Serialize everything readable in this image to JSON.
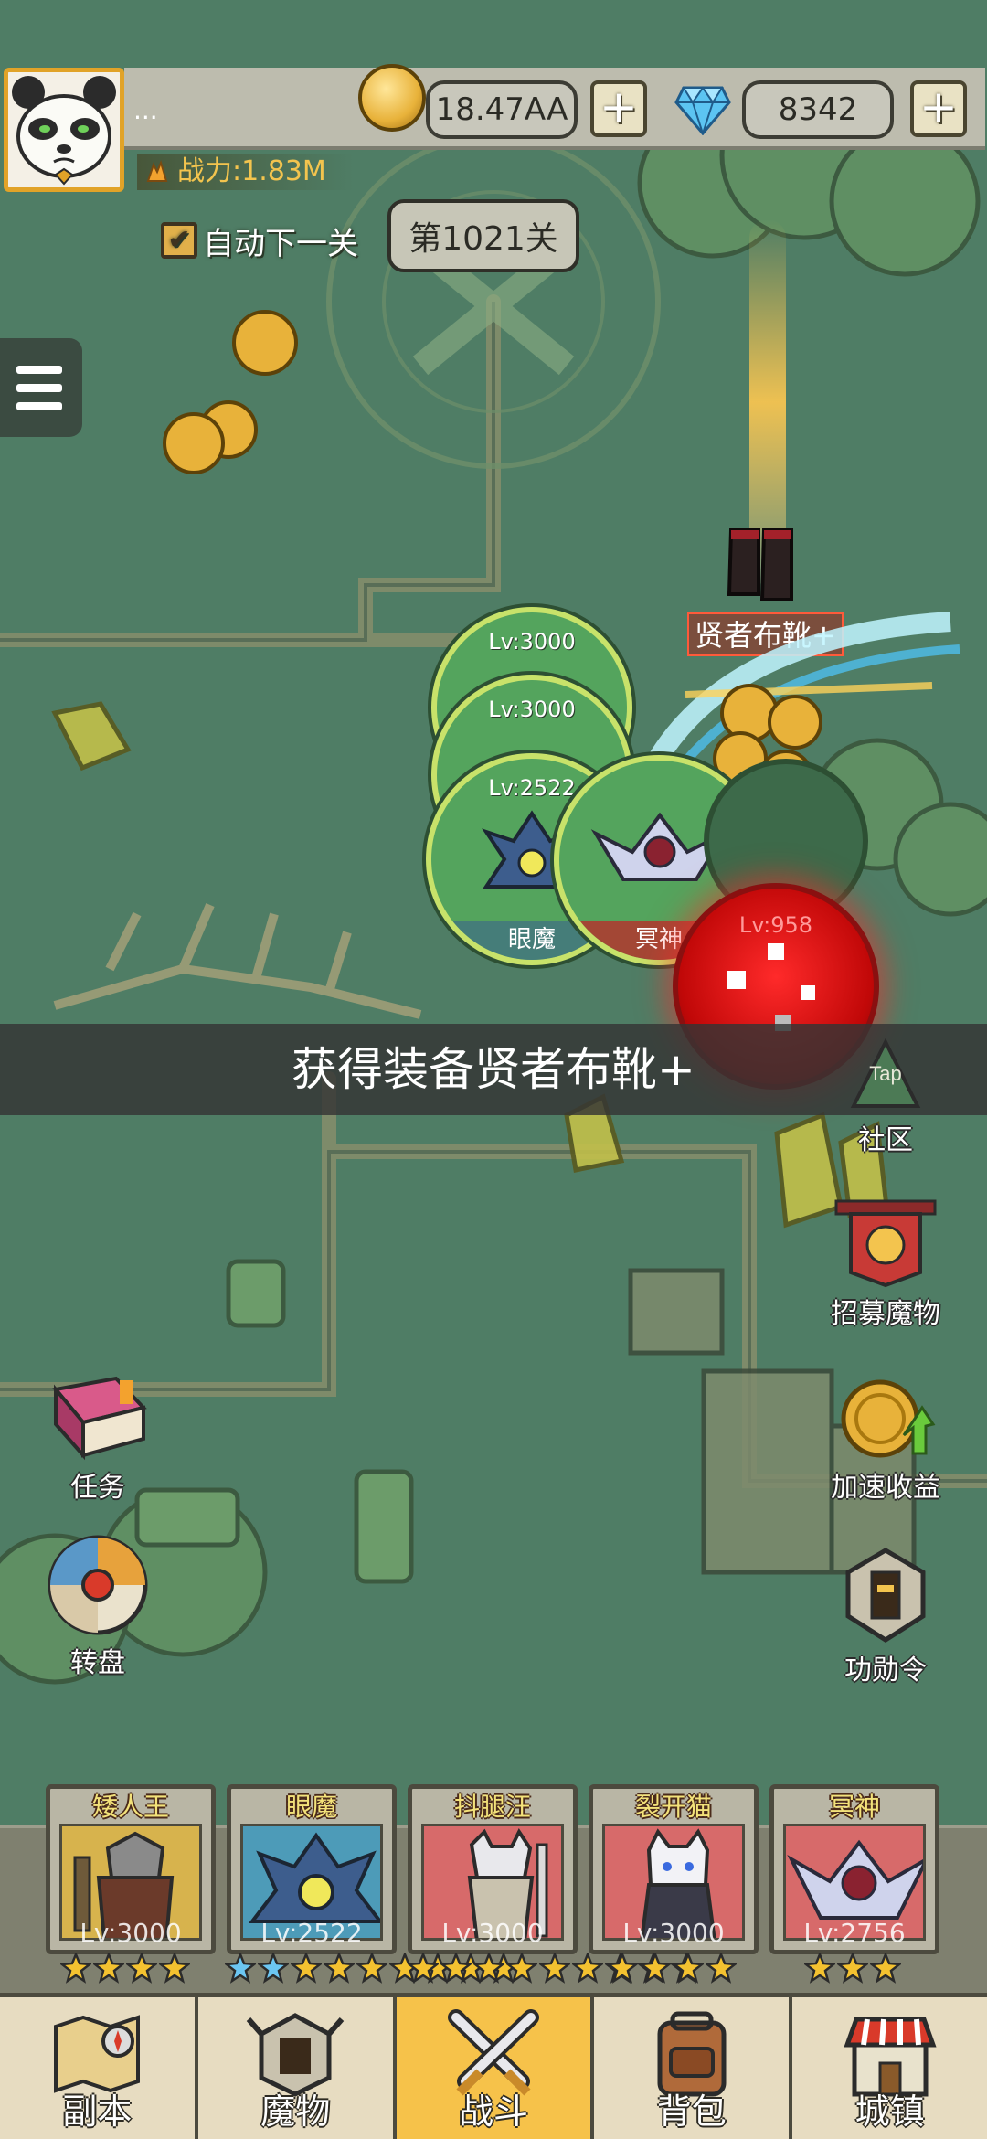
{
  "player": {
    "name": "...",
    "power_label": "战力:1.83M"
  },
  "currency": {
    "gold": "18.47AA",
    "gems": "8342",
    "plus": "+"
  },
  "stage": {
    "auto_next_label": "自动下一关",
    "auto_next_checked": true,
    "level_label": "第1021关"
  },
  "battle": {
    "allies": [
      {
        "level": "Lv:3000",
        "name": ""
      },
      {
        "level": "Lv:3000",
        "name": ""
      },
      {
        "level": "Lv:2522",
        "name": "眼魔"
      },
      {
        "level": "",
        "name": "冥神"
      }
    ],
    "enemy_level": "Lv:958",
    "loot_label": "贤者布靴+"
  },
  "notification": "获得装备贤者布靴+",
  "side_buttons": {
    "community": "社区",
    "recruit": "招募魔物",
    "boost": "加速收益",
    "merit": "功勋令",
    "quests": "任务",
    "wheel": "转盘",
    "tap_hint": "Tap"
  },
  "team": [
    {
      "name": "矮人王",
      "level": "Lv:3000",
      "stars": 4,
      "blue_stars": 0,
      "color": "#d7b34d"
    },
    {
      "name": "眼魔",
      "level": "Lv:2522",
      "stars": 9,
      "blue_stars": 2,
      "color": "#4d9bb8"
    },
    {
      "name": "抖腿汪",
      "level": "Lv:3000",
      "stars": 9,
      "blue_stars": 0,
      "color": "#d76a6a"
    },
    {
      "name": "裂开猫",
      "level": "Lv:3000",
      "stars": 4,
      "blue_stars": 0,
      "color": "#d76a6a"
    },
    {
      "name": "冥神",
      "level": "Lv:2756",
      "stars": 3,
      "blue_stars": 0,
      "color": "#d76a6a"
    }
  ],
  "nav": [
    {
      "label": "副本",
      "icon": "map-icon"
    },
    {
      "label": "魔物",
      "icon": "helmet-icon"
    },
    {
      "label": "战斗",
      "icon": "crossed-swords-icon",
      "active": true
    },
    {
      "label": "背包",
      "icon": "backpack-icon"
    },
    {
      "label": "城镇",
      "icon": "shop-icon"
    }
  ]
}
